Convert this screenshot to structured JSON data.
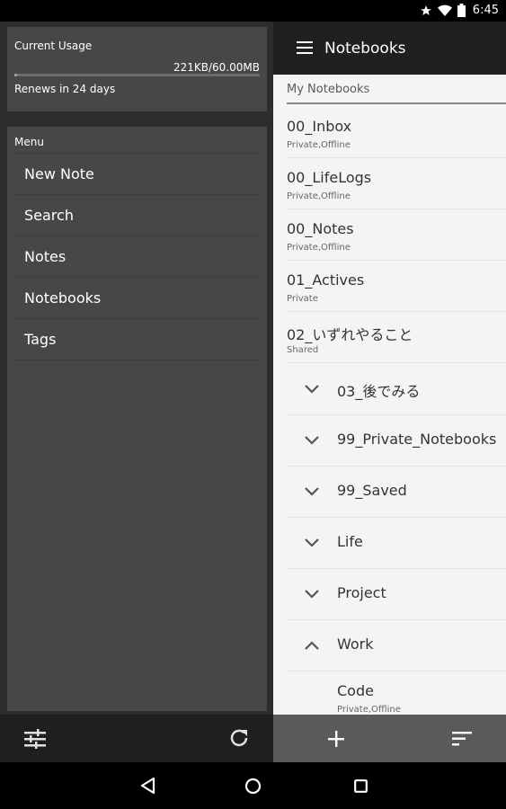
{
  "status": {
    "time": "6:45"
  },
  "usage": {
    "title": "Current Usage",
    "value": "221KB/60.00MB",
    "percent_used": 0.4,
    "renews": "Renews in 24 days"
  },
  "menu": {
    "title": "Menu",
    "items": [
      "New Note",
      "Search",
      "Notes",
      "Notebooks",
      "Tags"
    ]
  },
  "topbar": {
    "title": "Notebooks"
  },
  "section": {
    "header": "My Notebooks"
  },
  "notebooks": [
    {
      "name": "00_Inbox",
      "sub": "Private,Offline"
    },
    {
      "name": "00_LifeLogs",
      "sub": "Private,Offline"
    },
    {
      "name": "00_Notes",
      "sub": "Private,Offline"
    },
    {
      "name": "01_Actives",
      "sub": "Private"
    },
    {
      "name": "02_いずれやること",
      "sub": "Shared"
    }
  ],
  "stacks": [
    {
      "name": "03_後でみる",
      "expanded": false
    },
    {
      "name": "99_Private_Notebooks",
      "expanded": false
    },
    {
      "name": "99_Saved",
      "expanded": false
    },
    {
      "name": "Life",
      "expanded": false
    },
    {
      "name": "Project",
      "expanded": false
    },
    {
      "name": "Work",
      "expanded": true
    }
  ],
  "work_children": [
    {
      "name": "Code",
      "sub": "Private,Offline"
    }
  ],
  "colors": {
    "drawer_bg": "#2d2d2d",
    "card_bg": "#474747",
    "topbar_bg": "#202020",
    "content_bg": "#f4f4f4",
    "bottom_bar_bg": "#5a5a5a"
  },
  "icons": {
    "status": [
      "star-icon",
      "wifi-icon",
      "battery-icon"
    ],
    "drawer_bottom": [
      "settings-sliders-icon",
      "refresh-icon"
    ],
    "topbar": [
      "hamburger-icon"
    ],
    "bottom_bar": [
      "plus-icon",
      "sort-icon"
    ],
    "nav": [
      "back-icon",
      "home-icon",
      "recents-icon"
    ]
  }
}
